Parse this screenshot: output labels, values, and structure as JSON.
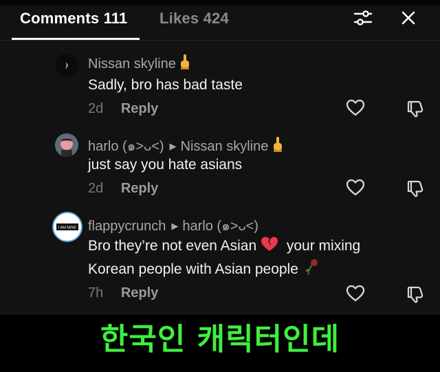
{
  "tabs": {
    "comments_label": "Comments 111",
    "likes_label": "Likes 424"
  },
  "header_icons": {
    "filter": "filter-sliders-icon",
    "close": "close-icon"
  },
  "comments": [
    {
      "username": "Nissan skyline",
      "text": "Sadly, bro has bad taste",
      "time": "2d",
      "reply_label": "Reply"
    },
    {
      "username": "harlo (๑˃ᴗ˂)",
      "reply_to": "Nissan skyline",
      "text": "just say you hate asians",
      "time": "2d",
      "reply_label": "Reply"
    },
    {
      "username": "flappycrunch",
      "reply_to": "harlo (๑˃ᴗ˂)",
      "text_line1": "Bro they’re not even Asian",
      "text_line1b": "your mixing",
      "text_line2": "Korean people with Asian people",
      "avatar_text": "I AM MINE",
      "time": "7h",
      "reply_label": "Reply"
    }
  ],
  "caption": "한국인 캐릭터인데",
  "colors": {
    "caption": "#3ef03e",
    "panel": "#121212",
    "username": "#a8a8a8"
  }
}
